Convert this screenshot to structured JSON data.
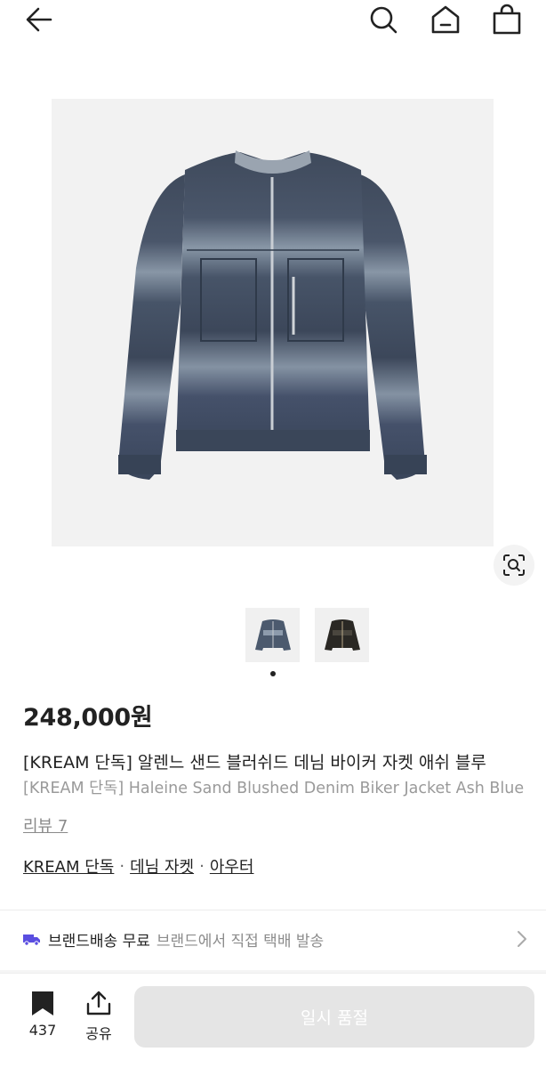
{
  "header": {
    "back_icon": "arrow-left-icon",
    "search_icon": "search-icon",
    "home_icon": "home-icon",
    "bag_icon": "shopping-bag-icon"
  },
  "gallery": {
    "lens_icon": "image-search-icon",
    "thumbnails": [
      "denim-jacket",
      "black-jacket"
    ]
  },
  "product": {
    "price": "248,000원",
    "title_ko": "[KREAM 단독] 알렌느 샌드 블러쉬드 데님 바이커 자켓 애쉬 블루",
    "title_en": "[KREAM 단독] Haleine Sand Blushed Denim Biker Jacket Ash Blue",
    "review_label": "리뷰 7",
    "categories": [
      "KREAM 단독",
      "데님 자켓",
      "아우터"
    ],
    "separator": "·"
  },
  "shipping": {
    "title": "브랜드배송 무료",
    "description": "브랜드에서 직접 택배 발송",
    "accent": "#5a4ee0"
  },
  "bottom_bar": {
    "bookmark_count": "437",
    "share_label": "공유",
    "action_label": "일시 품절"
  }
}
